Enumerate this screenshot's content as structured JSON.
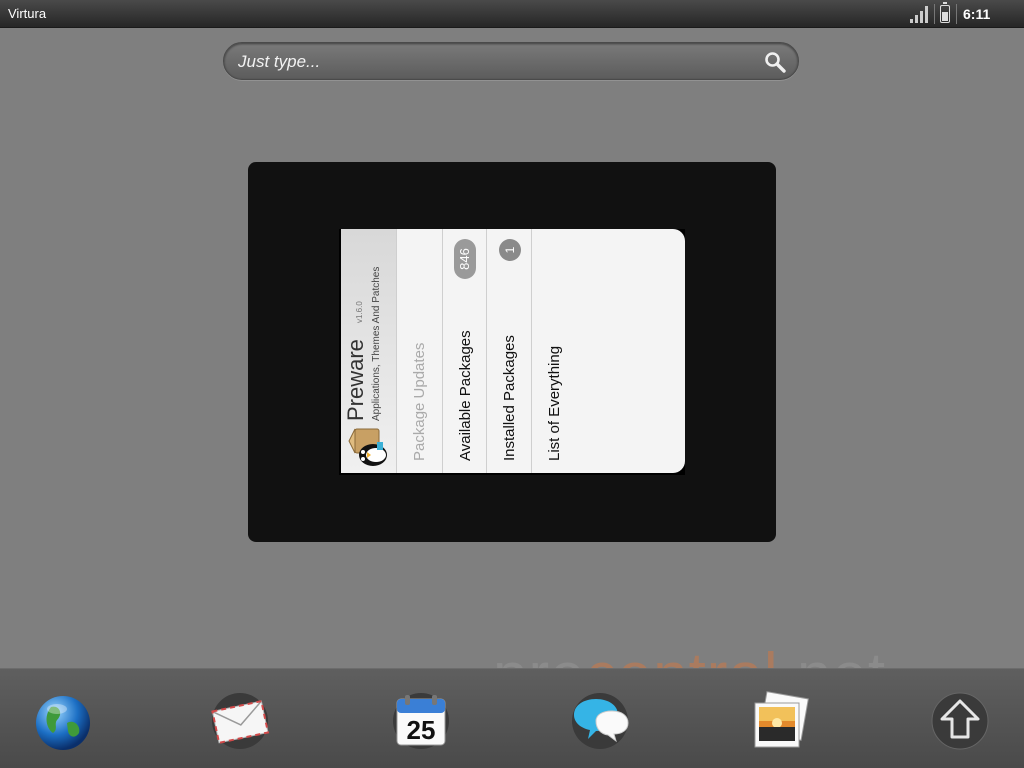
{
  "status_bar": {
    "carrier": "Virtura",
    "icons": [
      "signal-icon",
      "battery-icon"
    ],
    "time": "6:11"
  },
  "search": {
    "placeholder": "Just type...",
    "icon": "search-icon"
  },
  "card": {
    "app": {
      "title": "Preware",
      "version": "v1.6.0",
      "subtitle": "Applications, Themes And Patches",
      "icon": "preware-penguin-icon"
    },
    "items": [
      {
        "label": "Package Updates",
        "badge": ""
      },
      {
        "label": "Available Packages",
        "badge": "846"
      },
      {
        "label": "Installed Packages",
        "badge": "1"
      },
      {
        "label": "List of Everything",
        "badge": ""
      }
    ]
  },
  "watermark": {
    "part1": "pre",
    "part2": "central",
    "part3": ".net"
  },
  "dock": {
    "calendar_day": "25",
    "items": [
      "browser-globe-icon",
      "email-icon",
      "calendar-icon",
      "messaging-icon",
      "photos-icon",
      "launcher-icon"
    ]
  }
}
